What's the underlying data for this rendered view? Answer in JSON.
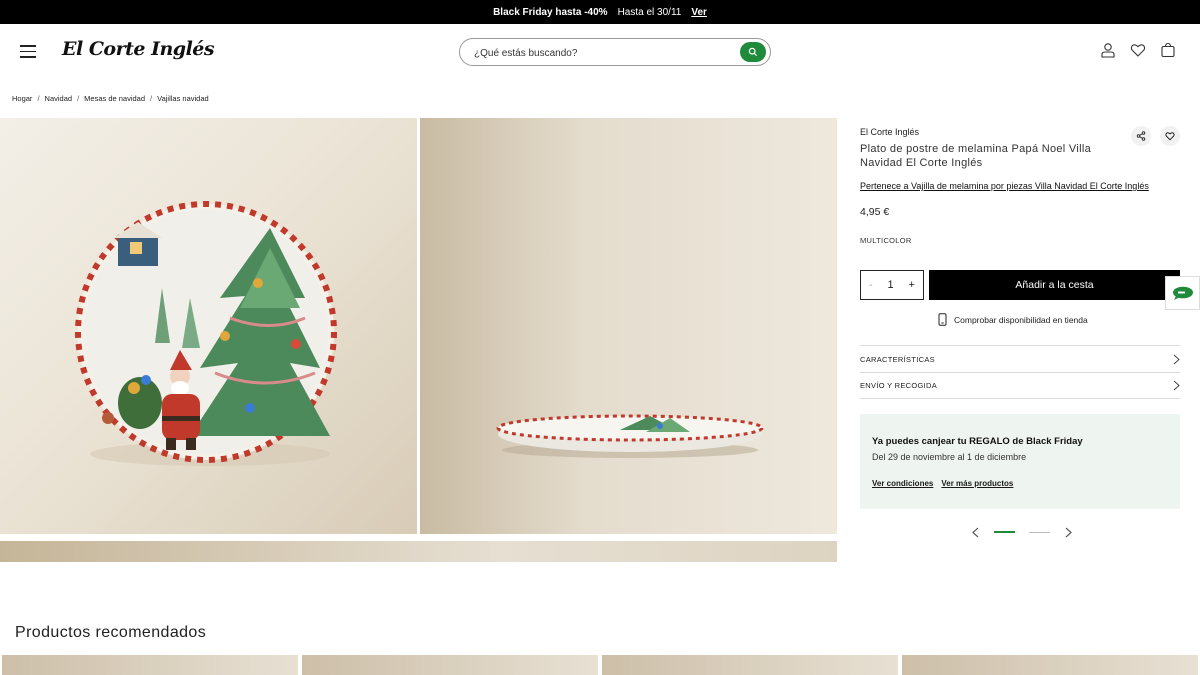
{
  "promo": {
    "headline": "Black Friday hasta -40%",
    "until": "Hasta el 30/11",
    "link": "Ver"
  },
  "header": {
    "logo": "El Corte Inglés",
    "search_placeholder": "¿Qué estás buscando?"
  },
  "breadcrumb": [
    "Hogar",
    "Navidad",
    "Mesas de navidad",
    "Vajillas navidad"
  ],
  "product": {
    "brand": "El Corte Inglés",
    "title": "Plato de postre de melamina Papá Noel Villa Navidad El Corte Inglés",
    "collection_link": "Pertenece a Vajilla de melamina por piezas Villa Navidad El Corte Inglés",
    "price": "4,95 €",
    "color": "MULTICOLOR",
    "quantity": "1",
    "qty_minus": "-",
    "qty_plus": "+",
    "add_to_cart": "Añadir a la cesta",
    "check_stock": "Comprobar disponibilidad en tienda"
  },
  "accordion": {
    "features": "CARACTERÍSTICAS",
    "shipping": "ENVÍO Y RECOGIDA"
  },
  "gift_promo": {
    "title": "Ya puedes canjear tu REGALO de Black Friday",
    "dates": "Del 29 de noviembre al 1 de diciembre",
    "link_conditions": "Ver condiciones",
    "link_products": "Ver más productos"
  },
  "carousel": {
    "slide_count": 2,
    "active_slide": 1
  },
  "recommended": {
    "title": "Productos recomendados"
  },
  "colors": {
    "accent_green": "#1f8a3b",
    "promo_bg": "#000000",
    "gift_card_bg": "#eef5f0"
  }
}
